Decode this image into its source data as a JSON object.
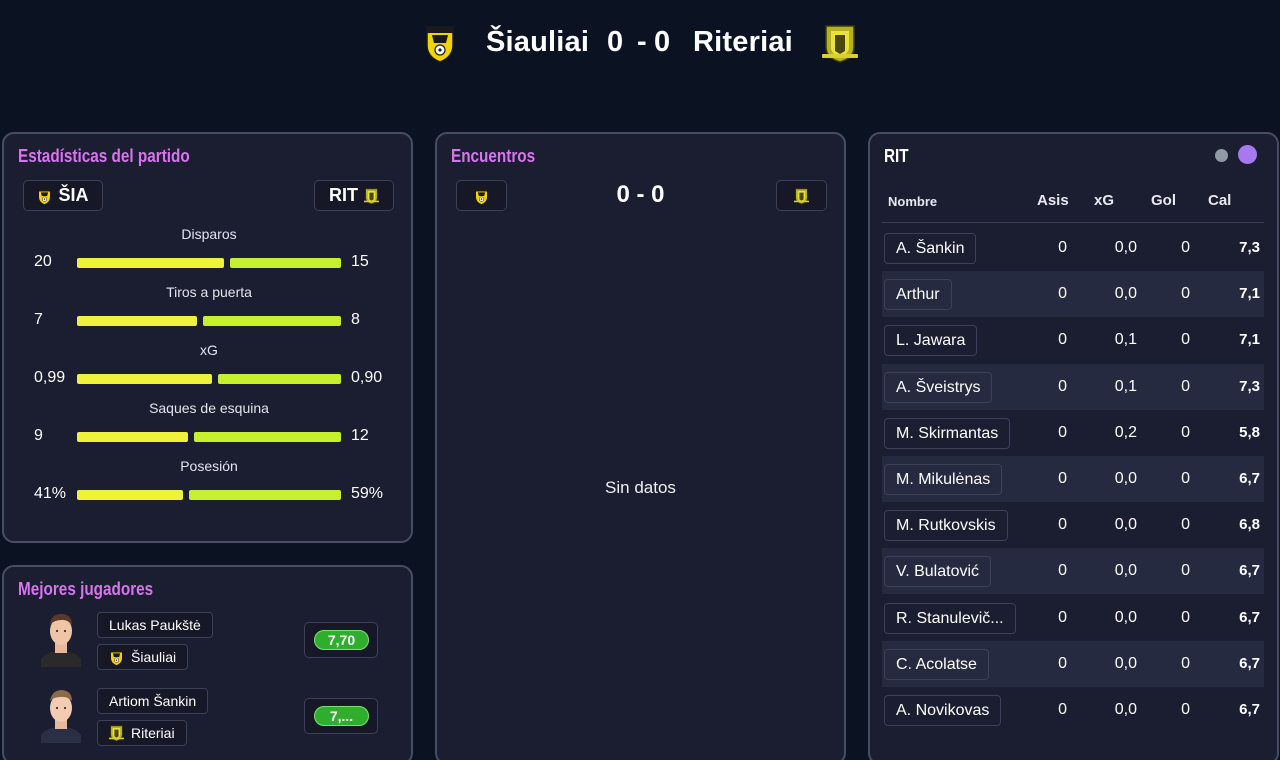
{
  "header": {
    "home_team": "Šiauliai",
    "away_team": "Riteriai",
    "home_score": "0",
    "separator": "-",
    "away_score": "0",
    "home_crest": "siauliai-crest-icon",
    "away_crest": "riteriai-crest-icon"
  },
  "colors": {
    "background": "#0b1222",
    "panel": "#1b1d31",
    "title_accent": "#d874f0",
    "bar_home": "#eef23a",
    "bar_away": "#c6ef2d",
    "rating_green": "#2fae2d",
    "dot_grey": "#8f9aa5",
    "dot_purple": "#a878f0"
  },
  "stats_panel": {
    "title": "Estadísticas del partido",
    "home_abbr": "ŠIA",
    "away_abbr": "RIT",
    "stats": [
      {
        "label": "Disparos",
        "home": "20",
        "away": "15",
        "home_share": 0.571
      },
      {
        "label": "Tiros a puerta",
        "home": "7",
        "away": "8",
        "home_share": 0.467
      },
      {
        "label": "xG",
        "home": "0,99",
        "away": "0,90",
        "home_share": 0.524
      },
      {
        "label": "Saques de esquina",
        "home": "9",
        "away": "12",
        "home_share": 0.429
      },
      {
        "label": "Posesión",
        "home": "41%",
        "away": "59%",
        "home_share": 0.41
      }
    ]
  },
  "best_players": {
    "title": "Mejores jugadores",
    "players": [
      {
        "name": "Lukas Paukštė",
        "team": "Šiauliai",
        "rating": "7,70"
      },
      {
        "name": "Artiom Šankin",
        "team": "Riteriai",
        "rating": "7,..."
      }
    ]
  },
  "h2h_panel": {
    "title": "Encuentros",
    "score": "0 - 0",
    "empty_text": "Sin datos"
  },
  "lineup_panel": {
    "title": "RIT",
    "columns": {
      "name": "Nombre",
      "assists": "Asis",
      "xg": "xG",
      "goals": "Gol",
      "rating": "Cal"
    },
    "players": [
      {
        "name": "A. Šankin",
        "assists": "0",
        "xg": "0,0",
        "goals": "0",
        "rating": "7,3"
      },
      {
        "name": "Arthur",
        "assists": "0",
        "xg": "0,0",
        "goals": "0",
        "rating": "7,1"
      },
      {
        "name": "L. Jawara",
        "assists": "0",
        "xg": "0,1",
        "goals": "0",
        "rating": "7,1"
      },
      {
        "name": "A. Šveistrys",
        "assists": "0",
        "xg": "0,1",
        "goals": "0",
        "rating": "7,3"
      },
      {
        "name": "M. Skirmantas",
        "assists": "0",
        "xg": "0,2",
        "goals": "0",
        "rating": "5,8"
      },
      {
        "name": "M. Mikulėnas",
        "assists": "0",
        "xg": "0,0",
        "goals": "0",
        "rating": "6,7"
      },
      {
        "name": "M. Rutkovskis",
        "assists": "0",
        "xg": "0,0",
        "goals": "0",
        "rating": "6,8"
      },
      {
        "name": "V. Bulatović",
        "assists": "0",
        "xg": "0,0",
        "goals": "0",
        "rating": "6,7"
      },
      {
        "name": "R. Stanulevičius",
        "display_name": "R. Stanulevič...",
        "assists": "0",
        "xg": "0,0",
        "goals": "0",
        "rating": "6,7"
      },
      {
        "name": "C. Acolatse",
        "assists": "0",
        "xg": "0,0",
        "goals": "0",
        "rating": "6,7"
      },
      {
        "name": "A. Novikovas",
        "assists": "0",
        "xg": "0,0",
        "goals": "0",
        "rating": "6,7"
      }
    ]
  }
}
